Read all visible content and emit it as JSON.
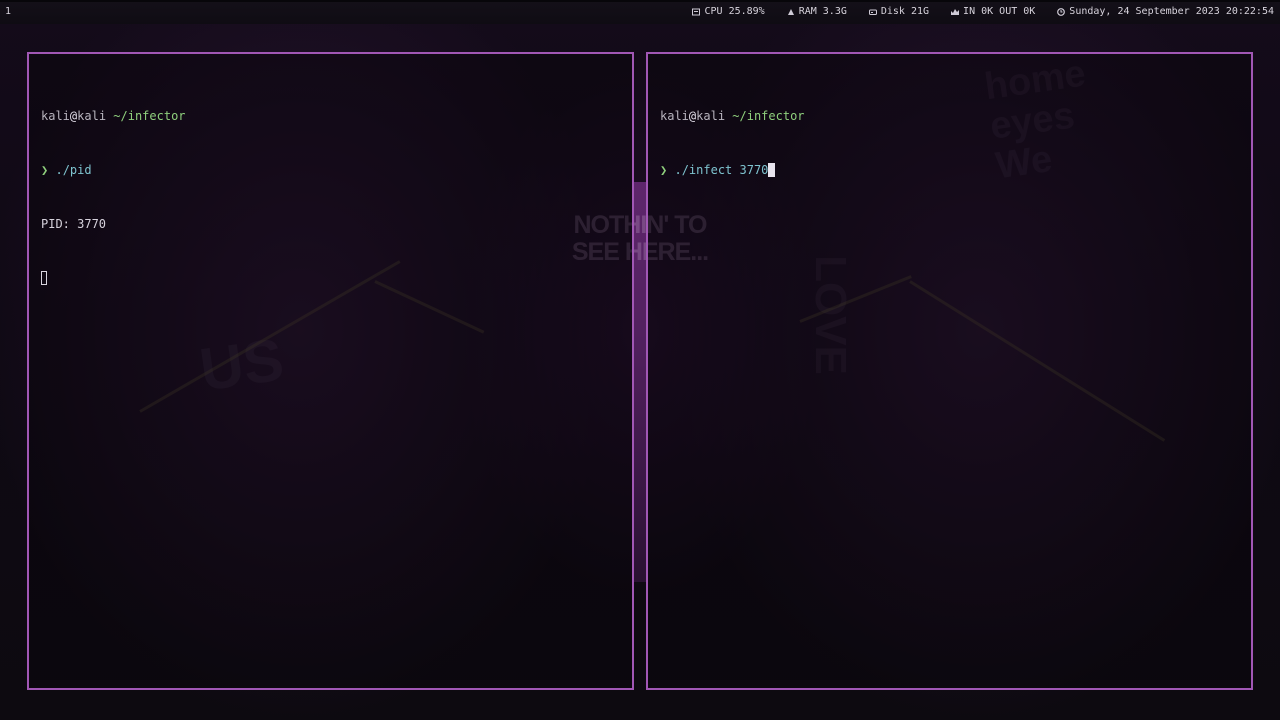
{
  "topbar": {
    "workspace": "1",
    "cpu": "CPU 25.89%",
    "ram": "RAM 3.3G",
    "disk": "Disk 21G",
    "net": "IN 0K OUT 0K",
    "clock": "Sunday, 24 September 2023 20:22:54",
    "icons": {
      "cpu": "cpu-icon",
      "ram": "ram-icon",
      "disk": "disk-icon",
      "net": "network-icon",
      "clock": "clock-icon"
    }
  },
  "wallpaper": {
    "sign_line1": "NOTHIN' TO",
    "sign_line2": "SEE HERE..."
  },
  "terminals": {
    "left": {
      "user": "kali",
      "at": "@",
      "host": "kali",
      "path": "~/infector",
      "prompt": "❯",
      "command": "./pid",
      "output": "PID: 3770"
    },
    "right": {
      "user": "kali",
      "at": "@",
      "host": "kali",
      "path": "~/infector",
      "prompt": "❯",
      "command": "./infect",
      "argument": "3770"
    }
  },
  "colors": {
    "border": "#a157b5",
    "prompt_green": "#8fd07d",
    "command_cyan": "#7ec3cf",
    "text": "#d6d2dc"
  }
}
